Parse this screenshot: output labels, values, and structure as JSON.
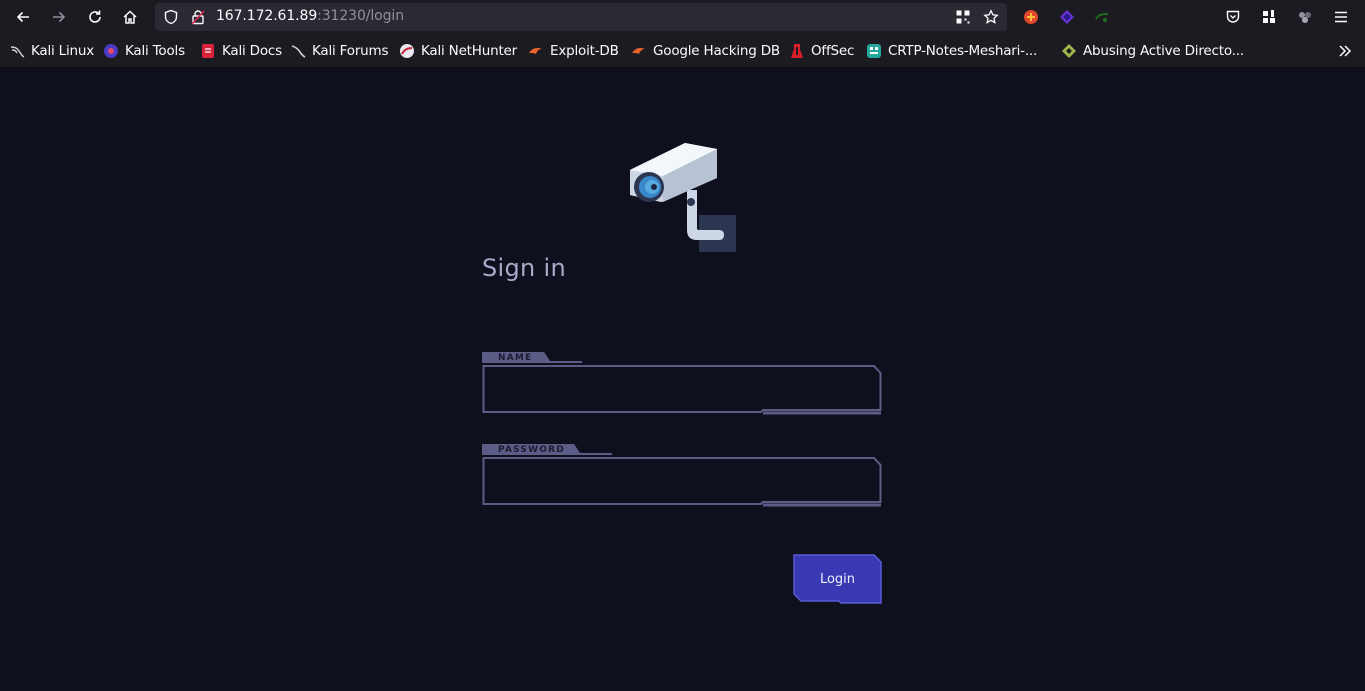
{
  "browser": {
    "url_host": "167.172.61.89",
    "url_rest": ":31230/login"
  },
  "bookmarks": [
    {
      "label": "Kali Linux",
      "icon": "kali-dragon-icon"
    },
    {
      "label": "Kali Tools",
      "icon": "kali-tools-icon"
    },
    {
      "label": "Kali Docs",
      "icon": "kali-docs-icon"
    },
    {
      "label": "Kali Forums",
      "icon": "kali-forums-icon"
    },
    {
      "label": "Kali NetHunter",
      "icon": "nethunter-icon"
    },
    {
      "label": "Exploit-DB",
      "icon": "exploit-db-icon"
    },
    {
      "label": "Google Hacking DB",
      "icon": "ghdb-icon"
    },
    {
      "label": "OffSec",
      "icon": "offsec-icon"
    },
    {
      "label": "CRTP-Notes-Meshari-...",
      "icon": "crtp-notes-icon"
    },
    {
      "label": "Abusing Active Directo...",
      "icon": "ad-icon"
    }
  ],
  "login": {
    "title": "Sign in",
    "name_label": "NAME",
    "name_value": "",
    "password_label": "PASSWORD",
    "password_value": "",
    "submit_label": "Login"
  },
  "colors": {
    "page_bg": "#0f101e",
    "field_border": "#5c5d87",
    "label_tab": "#5c5d87",
    "button_fill": "#3a39b4",
    "button_border": "#5a5ad6"
  }
}
